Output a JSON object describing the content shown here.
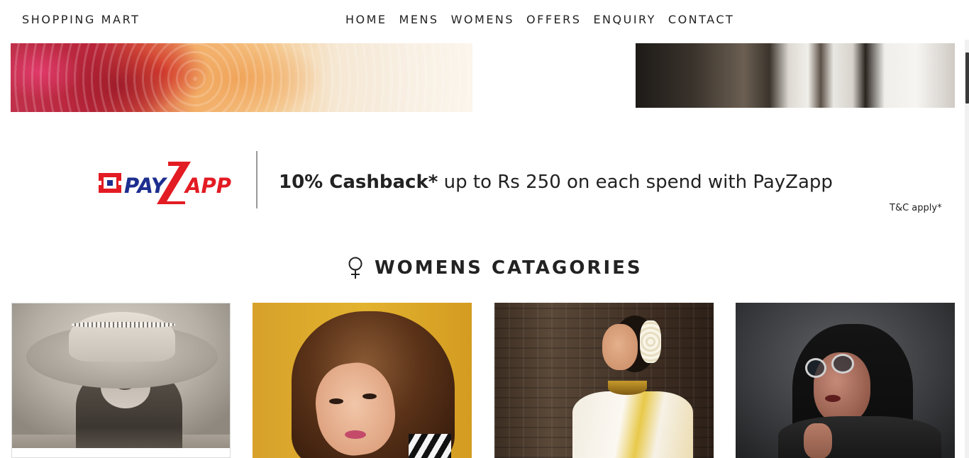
{
  "nav": {
    "brand": "SHOPPING MART",
    "links": [
      "HOME",
      "MENS",
      "WOMENS",
      "OFFERS",
      "ENQUIRY",
      "CONTACT"
    ]
  },
  "offer": {
    "logo_text": "PAYZAPP",
    "headline_bold": "10% Cashback*",
    "headline_rest": " up to Rs 250 on each spend with PayZapp",
    "tnc": "T&C apply*"
  },
  "section": {
    "icon": "female-icon",
    "title": "WOMENS CATAGORIES"
  },
  "colors": {
    "payzapp_red": "#e31b23",
    "payzapp_blue": "#1d2e8f",
    "text": "#222222"
  }
}
